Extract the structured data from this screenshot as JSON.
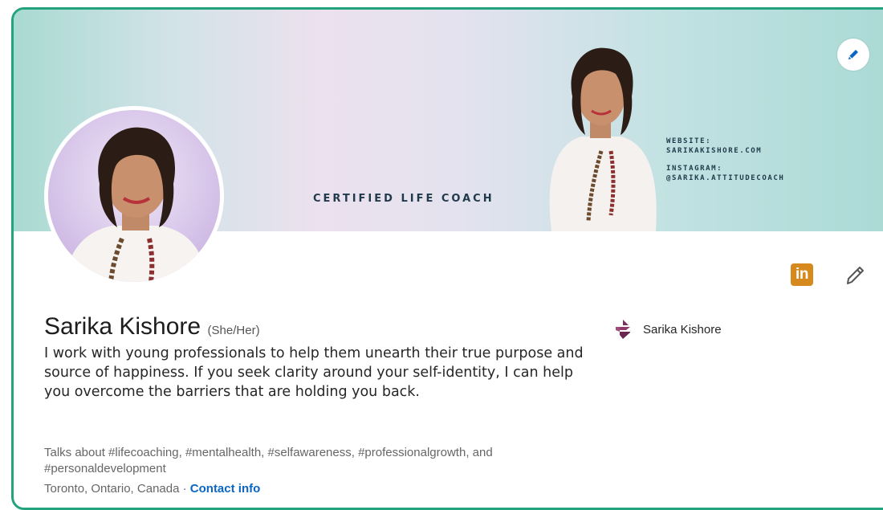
{
  "banner": {
    "tagline": "CERTIFIED LIFE COACH",
    "website_label": "WEBSITE:",
    "website_value": "SARIKAKISHORE.COM",
    "instagram_label": "INSTAGRAM:",
    "instagram_value": "@SARIKA.ATTITUDECOACH",
    "edit_icon": "pencil-icon"
  },
  "profile": {
    "name": "Sarika Kishore",
    "pronouns": "(She/Her)",
    "headline": "I work with young professionals to help them unearth their true purpose and source of happiness. If you seek clarity around your self-identity, I can help you overcome the barriers that are holding you back.",
    "talks_about": "Talks about #lifecoaching, #mentalhealth, #selfawareness, #professionalgrowth, and #personaldevelopment",
    "location": "Toronto, Ontario, Canada",
    "separator": " · ",
    "contact_link": "Contact info"
  },
  "company": {
    "name": "Sarika Kishore"
  },
  "badge": {
    "linkedin_text": "in"
  },
  "colors": {
    "border": "#22a37e",
    "link": "#0a66c2",
    "linkedin_badge": "#d68a1d",
    "edit_icon": "#0a66c2"
  }
}
